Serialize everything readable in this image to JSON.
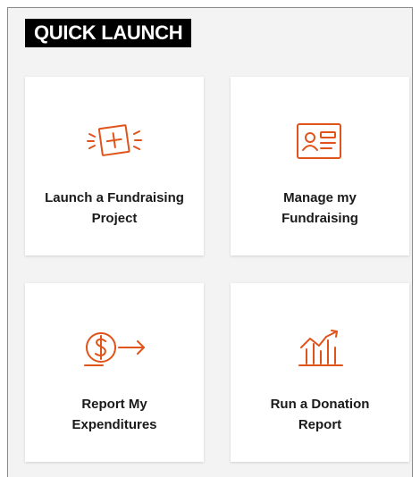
{
  "header": {
    "title": "QUICK LAUNCH"
  },
  "accent_color": "#e0531a",
  "tiles": [
    {
      "icon": "add-document-icon",
      "line1": "Launch a Fundraising",
      "line2": "Project"
    },
    {
      "icon": "id-card-icon",
      "line1": "Manage my",
      "line2": "Fundraising"
    },
    {
      "icon": "dollar-arrow-icon",
      "line1": "Report My",
      "line2": "Expenditures"
    },
    {
      "icon": "growth-chart-icon",
      "line1": "Run a Donation",
      "line2": "Report"
    }
  ]
}
